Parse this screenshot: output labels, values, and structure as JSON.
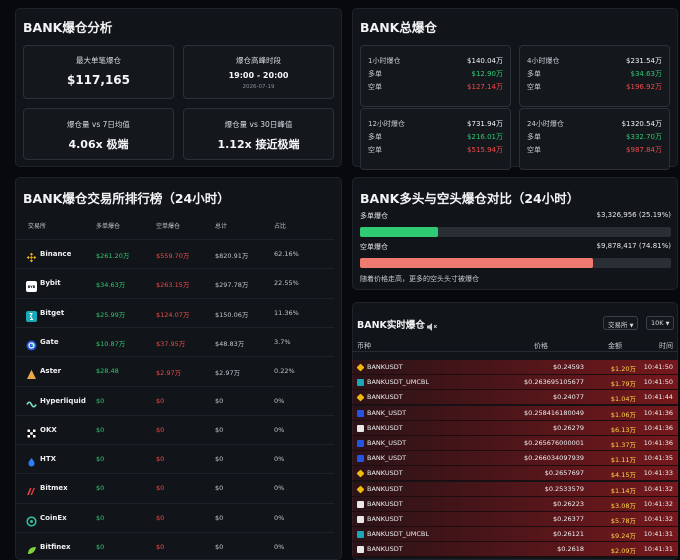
{
  "analysis": {
    "title": "BANK爆仓分析",
    "max_single": {
      "label": "最大单笔爆仓",
      "value": "$117,165"
    },
    "peak_period": {
      "label": "爆仓高峰时段",
      "value": "19:00 - 20:00",
      "date": "2026-07-19"
    },
    "vs7": {
      "label": "爆仓量 vs 7日均值",
      "value": "4.06x 极端"
    },
    "vs30": {
      "label": "爆仓量 vs 30日峰值",
      "value": "1.12x 接近极端"
    }
  },
  "totals": {
    "title": "BANK总爆仓",
    "long_label": "多单",
    "short_label": "空单",
    "periods": [
      {
        "label": "1小时爆仓",
        "total": "$140.04万",
        "long": "$12.90万",
        "short": "$127.14万"
      },
      {
        "label": "4小时爆仓",
        "total": "$231.54万",
        "long": "$34.63万",
        "short": "$196.92万"
      },
      {
        "label": "12小时爆仓",
        "total": "$731.94万",
        "long": "$216.01万",
        "short": "$515.94万"
      },
      {
        "label": "24小时爆仓",
        "total": "$1320.54万",
        "long": "$332.70万",
        "short": "$987.84万"
      }
    ]
  },
  "exchanges": {
    "title": "BANK爆仓交易所排行榜（24小时）",
    "headers": [
      "交易所",
      "多单爆仓",
      "空单爆仓",
      "总计",
      "占比"
    ],
    "rows": [
      {
        "name": "Binance",
        "icon": "binance-icon",
        "long": "$261.20万",
        "short": "$559.70万",
        "total": "$820.91万",
        "pct": "62.16%"
      },
      {
        "name": "Bybit",
        "icon": "bybit-icon",
        "long": "$34.63万",
        "short": "$263.15万",
        "total": "$297.78万",
        "pct": "22.55%"
      },
      {
        "name": "Bitget",
        "icon": "bitget-icon",
        "long": "$25.99万",
        "short": "$124.07万",
        "total": "$150.06万",
        "pct": "11.36%"
      },
      {
        "name": "Gate",
        "icon": "gate-icon",
        "long": "$10.87万",
        "short": "$37.95万",
        "total": "$48.83万",
        "pct": "3.7%"
      },
      {
        "name": "Aster",
        "icon": "aster-icon",
        "long": "$28.48",
        "short": "$2.97万",
        "total": "$2.97万",
        "pct": "0.22%"
      },
      {
        "name": "Hyperliquid",
        "icon": "hyperliquid-icon",
        "long": "$0",
        "short": "$0",
        "total": "$0",
        "pct": "0%"
      },
      {
        "name": "OKX",
        "icon": "okx-icon",
        "long": "$0",
        "short": "$0",
        "total": "$0",
        "pct": "0%"
      },
      {
        "name": "HTX",
        "icon": "htx-icon",
        "long": "$0",
        "short": "$0",
        "total": "$0",
        "pct": "0%"
      },
      {
        "name": "Bitmex",
        "icon": "bitmex-icon",
        "long": "$0",
        "short": "$0",
        "total": "$0",
        "pct": "0%"
      },
      {
        "name": "CoinEx",
        "icon": "coinex-icon",
        "long": "$0",
        "short": "$0",
        "total": "$0",
        "pct": "0%"
      },
      {
        "name": "Bitfinex",
        "icon": "bitfinex-icon",
        "long": "$0",
        "short": "$0",
        "total": "$0",
        "pct": "0%"
      }
    ]
  },
  "long_short": {
    "title": "BANK多头与空头爆仓对比（24小时）",
    "long": {
      "label": "多单爆仓",
      "value": "$3,326,956 (25.19%)",
      "fraction": 0.2519,
      "color": "#2fca73"
    },
    "short": {
      "label": "空单爆仓",
      "value": "$9,878,417 (74.81%)",
      "fraction": 0.7481,
      "color": "#f07a6f"
    },
    "note": "随着价格走高，更多的空头头寸被爆仓"
  },
  "live": {
    "title": "BANK实时爆仓",
    "sound_icon": "speaker-icon",
    "exchange_select": "交易所",
    "amount_select": "10K",
    "headers": [
      "币种",
      "价格",
      "金额",
      "时间"
    ],
    "rows": [
      {
        "symbol": "BANKUSDT",
        "ex": "binance",
        "price": "$0.24593",
        "amount": "$1.20万",
        "time": "10:41:50"
      },
      {
        "symbol": "BANKUSDT_UMCBL",
        "ex": "bitget",
        "price": "$0.263695105677",
        "amount": "$1.79万",
        "time": "10:41:50"
      },
      {
        "symbol": "BANKUSDT",
        "ex": "binance",
        "price": "$0.24077",
        "amount": "$1.04万",
        "time": "10:41:44"
      },
      {
        "symbol": "BANK_USDT",
        "ex": "gate",
        "price": "$0.258416180049",
        "amount": "$1.06万",
        "time": "10:41:36"
      },
      {
        "symbol": "BANKUSDT",
        "ex": "bybit",
        "price": "$0.26279",
        "amount": "$6.13万",
        "time": "10:41:36"
      },
      {
        "symbol": "BANK_USDT",
        "ex": "gate",
        "price": "$0.265676000001",
        "amount": "$1.37万",
        "time": "10:41:36"
      },
      {
        "symbol": "BANK_USDT",
        "ex": "gate",
        "price": "$0.266034097939",
        "amount": "$1.11万",
        "time": "10:41:35"
      },
      {
        "symbol": "BANKUSDT",
        "ex": "binance",
        "price": "$0.2657697",
        "amount": "$4.15万",
        "time": "10:41:33"
      },
      {
        "symbol": "BANKUSDT",
        "ex": "binance",
        "price": "$0.2533579",
        "amount": "$1.14万",
        "time": "10:41:32"
      },
      {
        "symbol": "BANKUSDT",
        "ex": "bybit",
        "price": "$0.26223",
        "amount": "$3.08万",
        "time": "10:41:32"
      },
      {
        "symbol": "BANKUSDT",
        "ex": "bybit",
        "price": "$0.26377",
        "amount": "$5.78万",
        "time": "10:41:32"
      },
      {
        "symbol": "BANKUSDT_UMCBL",
        "ex": "bitget",
        "price": "$0.26121",
        "amount": "$9.24万",
        "time": "10:41:31"
      },
      {
        "symbol": "BANKUSDT",
        "ex": "bybit",
        "price": "$0.2618",
        "amount": "$2.09万",
        "time": "10:41:31"
      }
    ]
  }
}
